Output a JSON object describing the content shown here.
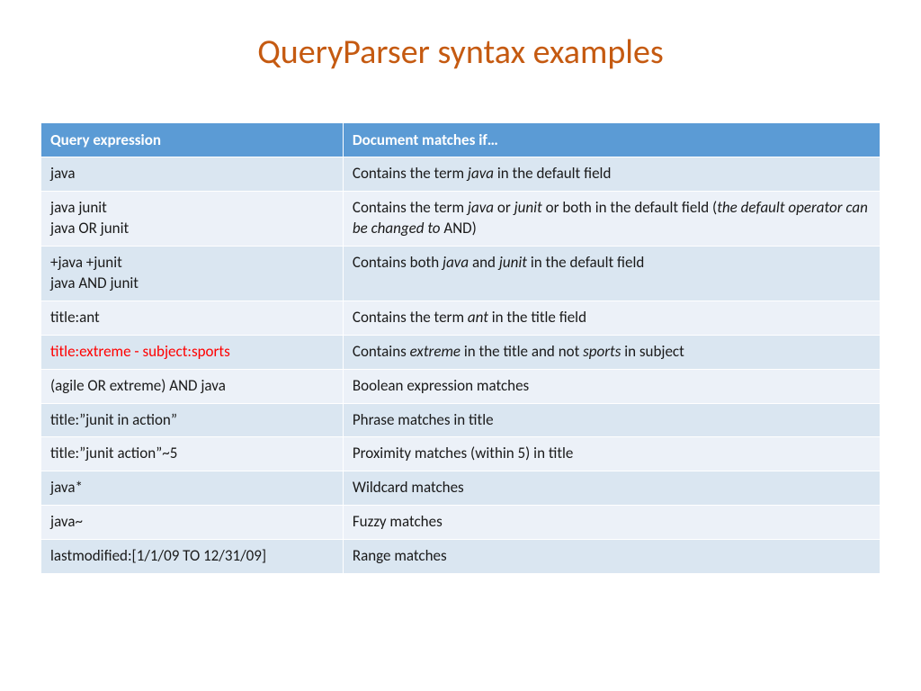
{
  "title": "QueryParser syntax examples",
  "columns": [
    "Query expression",
    "Document matches if…"
  ],
  "rows": [
    {
      "expr": [
        {
          "t": "java"
        }
      ],
      "desc": [
        {
          "t": "Contains the term "
        },
        {
          "t": "java",
          "i": true
        },
        {
          "t": " in the default field"
        }
      ]
    },
    {
      "expr": [
        {
          "t": "java junit"
        },
        {
          "br": true
        },
        {
          "t": "java OR junit"
        }
      ],
      "desc": [
        {
          "t": "Contains the term "
        },
        {
          "t": "java",
          "i": true
        },
        {
          "t": " or "
        },
        {
          "t": "junit",
          "i": true
        },
        {
          "t": " or both in the default field ("
        },
        {
          "t": "the default operator can be changed to ",
          "i": true
        },
        {
          "t": "AND)"
        }
      ]
    },
    {
      "expr": [
        {
          "t": "+java +junit"
        },
        {
          "br": true
        },
        {
          "t": "java AND junit"
        }
      ],
      "desc": [
        {
          "t": "Contains both "
        },
        {
          "t": "java",
          "i": true
        },
        {
          "t": " and "
        },
        {
          "t": "junit",
          "i": true
        },
        {
          "t": " in the default field"
        }
      ]
    },
    {
      "expr": [
        {
          "t": "title:ant"
        }
      ],
      "desc": [
        {
          "t": "Contains the term "
        },
        {
          "t": "ant",
          "i": true
        },
        {
          "t": " in the title field"
        }
      ]
    },
    {
      "expr": [
        {
          "t": "title:extreme - subject:sports",
          "red": true
        }
      ],
      "desc": [
        {
          "t": "Contains "
        },
        {
          "t": "extreme",
          "i": true
        },
        {
          "t": " in the title and not "
        },
        {
          "t": "sports",
          "i": true
        },
        {
          "t": " in subject"
        }
      ]
    },
    {
      "expr": [
        {
          "t": "(agile OR extreme) AND java"
        }
      ],
      "desc": [
        {
          "t": "Boolean expression matches"
        }
      ]
    },
    {
      "expr": [
        {
          "t": "title:”junit in action”"
        }
      ],
      "desc": [
        {
          "t": "Phrase matches in title"
        }
      ]
    },
    {
      "expr": [
        {
          "t": "title:”junit action”~5"
        }
      ],
      "desc": [
        {
          "t": "Proximity matches (within 5) in title"
        }
      ]
    },
    {
      "expr": [
        {
          "t": "java*"
        }
      ],
      "desc": [
        {
          "t": "Wildcard matches"
        }
      ]
    },
    {
      "expr": [
        {
          "t": "java~"
        }
      ],
      "desc": [
        {
          "t": "Fuzzy matches"
        }
      ]
    },
    {
      "expr": [
        {
          "t": "lastmodified:[1/1/09 TO 12/31/09]"
        }
      ],
      "desc": [
        {
          "t": "Range matches"
        }
      ]
    }
  ]
}
